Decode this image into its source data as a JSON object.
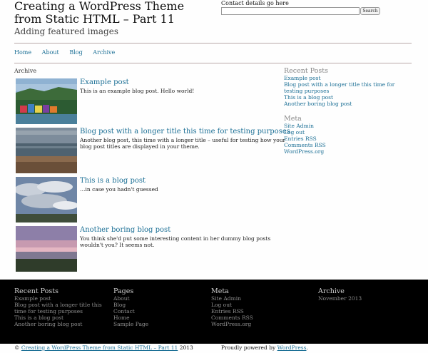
{
  "header": {
    "title": "Creating a WordPress Theme from Static HTML – Part 11",
    "description": "Adding featured images",
    "contact": "Contact details go here",
    "search_value": "",
    "search_button": "Search"
  },
  "nav": [
    "Home",
    "About",
    "Blog",
    "Archive"
  ],
  "archive_label": "Archive",
  "posts": [
    {
      "title": "Example post",
      "excerpt": "This is an example blog post. Hello world!"
    },
    {
      "title": "Blog post with a longer title this time for testing purposes",
      "excerpt": "Another blog post, this time with a longer title – useful for testing how your blog post titles are displayed in your theme."
    },
    {
      "title": "This is a blog post",
      "excerpt": "…in case you hadn't guessed"
    },
    {
      "title": "Another boring blog post",
      "excerpt": "You think she'd put some interesting content in her dummy blog posts wouldn't you? It seems not."
    }
  ],
  "sidebar": {
    "recent_title": "Recent Posts",
    "recent": [
      "Example post",
      "Blog post with a longer title this time for testing purposes",
      "This is a blog post",
      "Another boring blog post"
    ],
    "meta_title": "Meta",
    "meta": [
      "Site Admin",
      "Log out",
      "Entries RSS",
      "Comments RSS",
      "WordPress.org"
    ]
  },
  "footer": {
    "recent_title": "Recent Posts",
    "recent": [
      "Example post",
      "Blog post with a longer title this time for testing purposes",
      "This is a blog post",
      "Another boring blog post"
    ],
    "pages_title": "Pages",
    "pages": [
      "About",
      "Blog",
      "Contact",
      "Home",
      "Sample Page"
    ],
    "meta_title": "Meta",
    "meta": [
      "Site Admin",
      "Log out",
      "Entries RSS",
      "Comments RSS",
      "WordPress.org"
    ],
    "archive_title": "Archive",
    "archive": [
      "November 2013"
    ]
  },
  "bottom": {
    "copyright_symbol": "©",
    "copyright_link": "Creating a WordPress Theme from Static HTML – Part 11",
    "year": "2013",
    "powered_prefix": "Proudly powered by",
    "powered_link": "WordPress",
    "powered_suffix": "."
  },
  "colors": {
    "link": "#1b6f95",
    "footer_bg": "#000000",
    "rule": "#b9a9a9"
  }
}
